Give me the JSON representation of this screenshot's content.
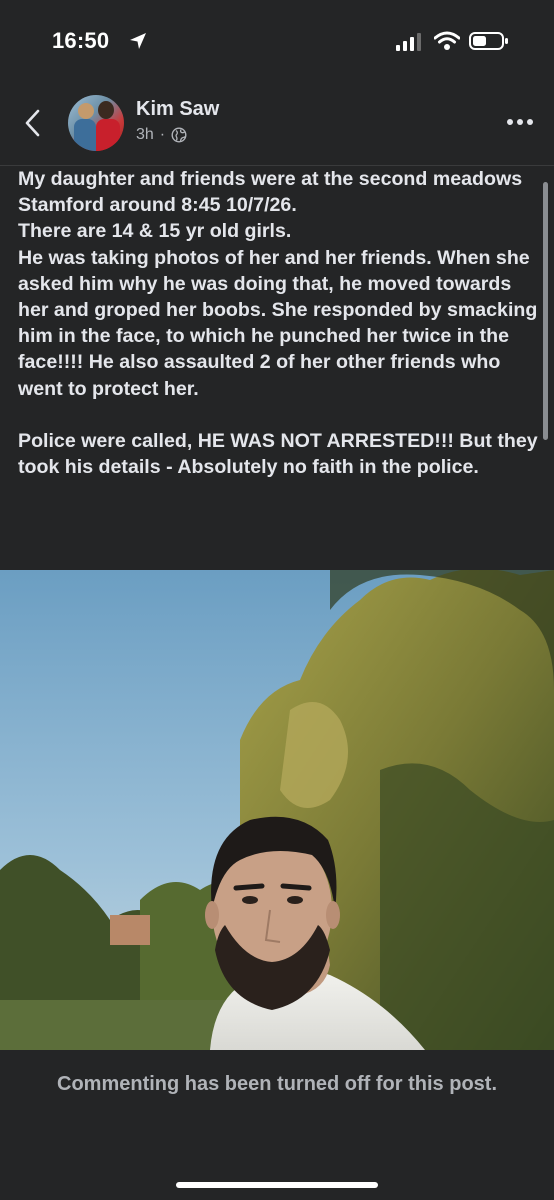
{
  "status_bar": {
    "time": "16:50",
    "icons": [
      "location-arrow-icon",
      "cellular-signal-icon",
      "wifi-icon",
      "battery-icon"
    ]
  },
  "header": {
    "author": "Kim Saw",
    "time_ago": "3h",
    "separator": "·",
    "audience_icon": "globe-icon",
    "back_icon": "chevron-left-icon",
    "more_icon": "more-horizontal-icon"
  },
  "post": {
    "text": "My daughter and friends were at the second meadows Stamford around 8:45 10/7/26.\nThere are 14 & 15 yr old girls.\nHe was taking photos of her and her friends. When she asked him why he was doing that, he moved towards her and groped her boobs. She responded by smacking him in the face, to which he punched her twice in the face!!!! He also assaulted 2 of her other friends who went to protect her.\n\nPolice were called, HE WAS NOT ARRESTED!!! But they took his details - Absolutely no faith in the police."
  },
  "footer": {
    "comments_notice": "Commenting has been turned off for this post."
  },
  "colors": {
    "background": "#242526",
    "text_primary": "#e4e6eb",
    "text_secondary": "#b0b3b8",
    "divider": "#3a3b3c"
  }
}
